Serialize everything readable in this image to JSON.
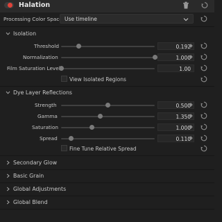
{
  "header": {
    "title": "Halation",
    "icons": [
      "toggle-icon",
      "trash-icon",
      "reset-icon"
    ]
  },
  "processing": {
    "label": "Processing Color Space",
    "value": "Use timeline"
  },
  "isolation": {
    "title": "Isolation",
    "threshold": {
      "label": "Threshold",
      "value": "0.192",
      "level": 0.192
    },
    "normalization": {
      "label": "Normalization",
      "value": "1.000",
      "level": 1.0
    },
    "film_saturation": {
      "label": "Film Saturation Level",
      "value": "1.00",
      "level": 0.0
    },
    "view_isolated": {
      "label": "View Isolated Regions",
      "checked": false
    }
  },
  "dye": {
    "title": "Dye Layer Reflections",
    "strength": {
      "label": "Strength",
      "value": "0.500",
      "level": 0.5
    },
    "gamma": {
      "label": "Gamma",
      "value": "1.350",
      "level": 0.42
    },
    "saturation": {
      "label": "Saturation",
      "value": "1.000",
      "level": 0.33
    },
    "spread": {
      "label": "Spread",
      "value": "0.110",
      "level": 0.11
    },
    "fine_tune": {
      "label": "Fine Tune Relative Spread",
      "checked": false
    }
  },
  "collapsed_sections": [
    {
      "label": "Secondary Glow"
    },
    {
      "label": "Basic Grain"
    },
    {
      "label": "Global Adjustments"
    },
    {
      "label": "Global Blend"
    }
  ],
  "colors": {
    "accent_red": "#e0433a",
    "panel_bg": "#1f1f1f",
    "header_bg": "#2a2a2a"
  }
}
